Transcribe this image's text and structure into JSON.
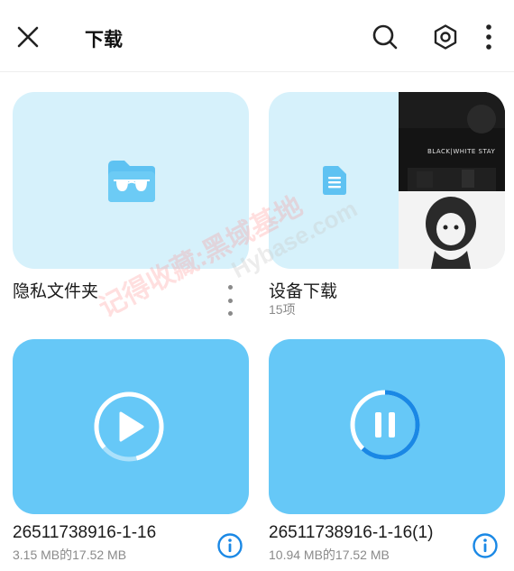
{
  "header": {
    "title": "下载",
    "icons": [
      "close-icon",
      "search-icon",
      "settings-hexagon-icon",
      "more-vertical-icon"
    ]
  },
  "grid": {
    "private_folder": {
      "label": "隐私文件夹",
      "icon": "glasses-folder-icon"
    },
    "device_downloads": {
      "label": "设备下载",
      "count": "15项",
      "icon": "document-icon",
      "thumb_text": "BLACK|WHITE STAY"
    },
    "video1": {
      "name": "26511738916-1-16",
      "progress_text": "3.15 MB的17.52 MB",
      "state": "paused",
      "progress": 0.18
    },
    "video2": {
      "name": "26511738916-1-16(1)",
      "progress_text": "10.94 MB的17.52 MB",
      "state": "downloading",
      "progress": 0.62
    }
  },
  "watermark": {
    "text": "记得收藏:黑域基地",
    "site": "Hybase.com"
  },
  "colors": {
    "card_light": "#d6f1fb",
    "card_video": "#66c8f7",
    "accent": "#1a88e5",
    "folder_icon": "#5ec2f2"
  }
}
